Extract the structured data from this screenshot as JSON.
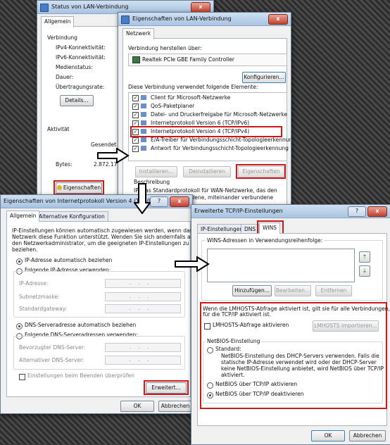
{
  "status_win": {
    "title": "Status von LAN-Verbindung",
    "tab": "Allgemein",
    "connection": "Verbindung",
    "ipv4": "IPv4-Konnektivität:",
    "ipv6": "IPv6-Konnektivität:",
    "media": "Medienstatus:",
    "duration": "Dauer:",
    "speed": "Übertragungsrate:",
    "details": "Details...",
    "activity": "Aktivität",
    "sent": "Gesendet",
    "bytes_label": "Bytes:",
    "bytes_value": "2.872.17",
    "properties": "Eigenschaften",
    "close_label": "x"
  },
  "lan_win": {
    "title": "Eigenschaften von LAN-Verbindung",
    "close_label": "x",
    "tab": "Netzwerk",
    "connect_using": "Verbindung herstellen über:",
    "adapter": "Realtek PCIe GBE Family Controller",
    "configure": "Konfigurieren...",
    "uses_items": "Diese Verbindung verwendet folgende Elemente:",
    "items": [
      "Client für Microsoft-Netzwerke",
      "QoS-Paketplaner",
      "Datei- und Druckerfreigabe für Microsoft-Netzwerke",
      "Internetprotokoll Version 6 (TCP/IPv6)",
      "Internetprotokoll Version 4 (TCP/IPv4)",
      "E/A-Treiber für Verbindungsschicht-Topologieerkennun...",
      "Antwort für Verbindungsschicht-Topologieerkennung"
    ],
    "check": "✓",
    "install": "Installieren...",
    "uninstall": "Deinstallieren",
    "properties": "Eigenschaften",
    "description": "Beschreibung",
    "desc_line1": "IP, das Standardprotokoll für WAN-Netzwerke, das den",
    "desc_line2": "hiedene, miteinander verbundene"
  },
  "ipv4_win": {
    "title": "Eigenschaften von Internetprotokoll Version 4 (TCP/IPv4)",
    "help_label": "?",
    "close_label": "x",
    "tab_general": "Allgemein",
    "tab_alt": "Alternative Konfiguration",
    "intro1": "IP-Einstellungen können automatisch zugewiesen werden, wenn das",
    "intro2": "Netzwerk diese Funktion unterstützt. Wenden Sie sich andernfalls an",
    "intro3": "den Netzwerkadministrator, um die geeigneten IP-Einstellungen zu",
    "intro4": "beziehen.",
    "auto_ip": "IP-Adresse automatisch beziehen",
    "use_ip": "Folgende IP-Adresse verwenden:",
    "ip_addr": "IP-Adresse:",
    "subnet": "Subnetzmaske:",
    "gateway": "Standardgateway:",
    "auto_dns": "DNS-Serveradresse automatisch beziehen",
    "use_dns": "Folgende DNS-Serveradressen verwenden:",
    "pref_dns": "Bevorzugter DNS-Server:",
    "alt_dns": "Alternativer DNS-Server:",
    "validate": "Einstellungen beim Beenden überprüfen",
    "advanced": "Erweitert...",
    "ok": "OK",
    "cancel": "Abbrechen",
    "ip_dots": "..."
  },
  "tcp_win": {
    "title": "Erweiterte TCP/IP-Einstellungen",
    "help_label": "?",
    "close_label": "x",
    "tab_ip": "IP-Einstellungen",
    "tab_dns": "DNS",
    "tab_wins": "WINS",
    "wins_order": "WINS-Adressen in Verwendungsreihenfolge:",
    "up_label": "⇡",
    "down_label": "⇣",
    "add": "Hinzufügen...",
    "edit": "Bearbeiten...",
    "remove": "Entfernen",
    "lmhosts_info1": "Wenn die LMHOSTS-Abfrage aktiviert ist, gilt sie für alle Verbindungen,",
    "lmhosts_info2": "für die TCP/IP aktiviert ist.",
    "lmhosts_check": "LMHOSTS-Abfrage aktivieren",
    "lmhosts_import": "LMHOSTS importieren...",
    "netbios": "NetBIOS-Einstellung",
    "standard": "Standard:",
    "std1": "NetBIOS-Einstellung des DHCP-Servers verwenden. Falls die",
    "std2": "statische IP-Adresse verwendet wird oder der DHCP-Server",
    "std3": "keine NetBIOS-Einstellung anbietet, wird NetBIOS über TCP/IP",
    "std4": "aktiviert.",
    "enable_nb": "NetBIOS über TCP/IP aktivieren",
    "disable_nb": "NetBIOS über TCP/IP deaktivieren",
    "ok": "OK",
    "cancel": "Abbrechen"
  }
}
